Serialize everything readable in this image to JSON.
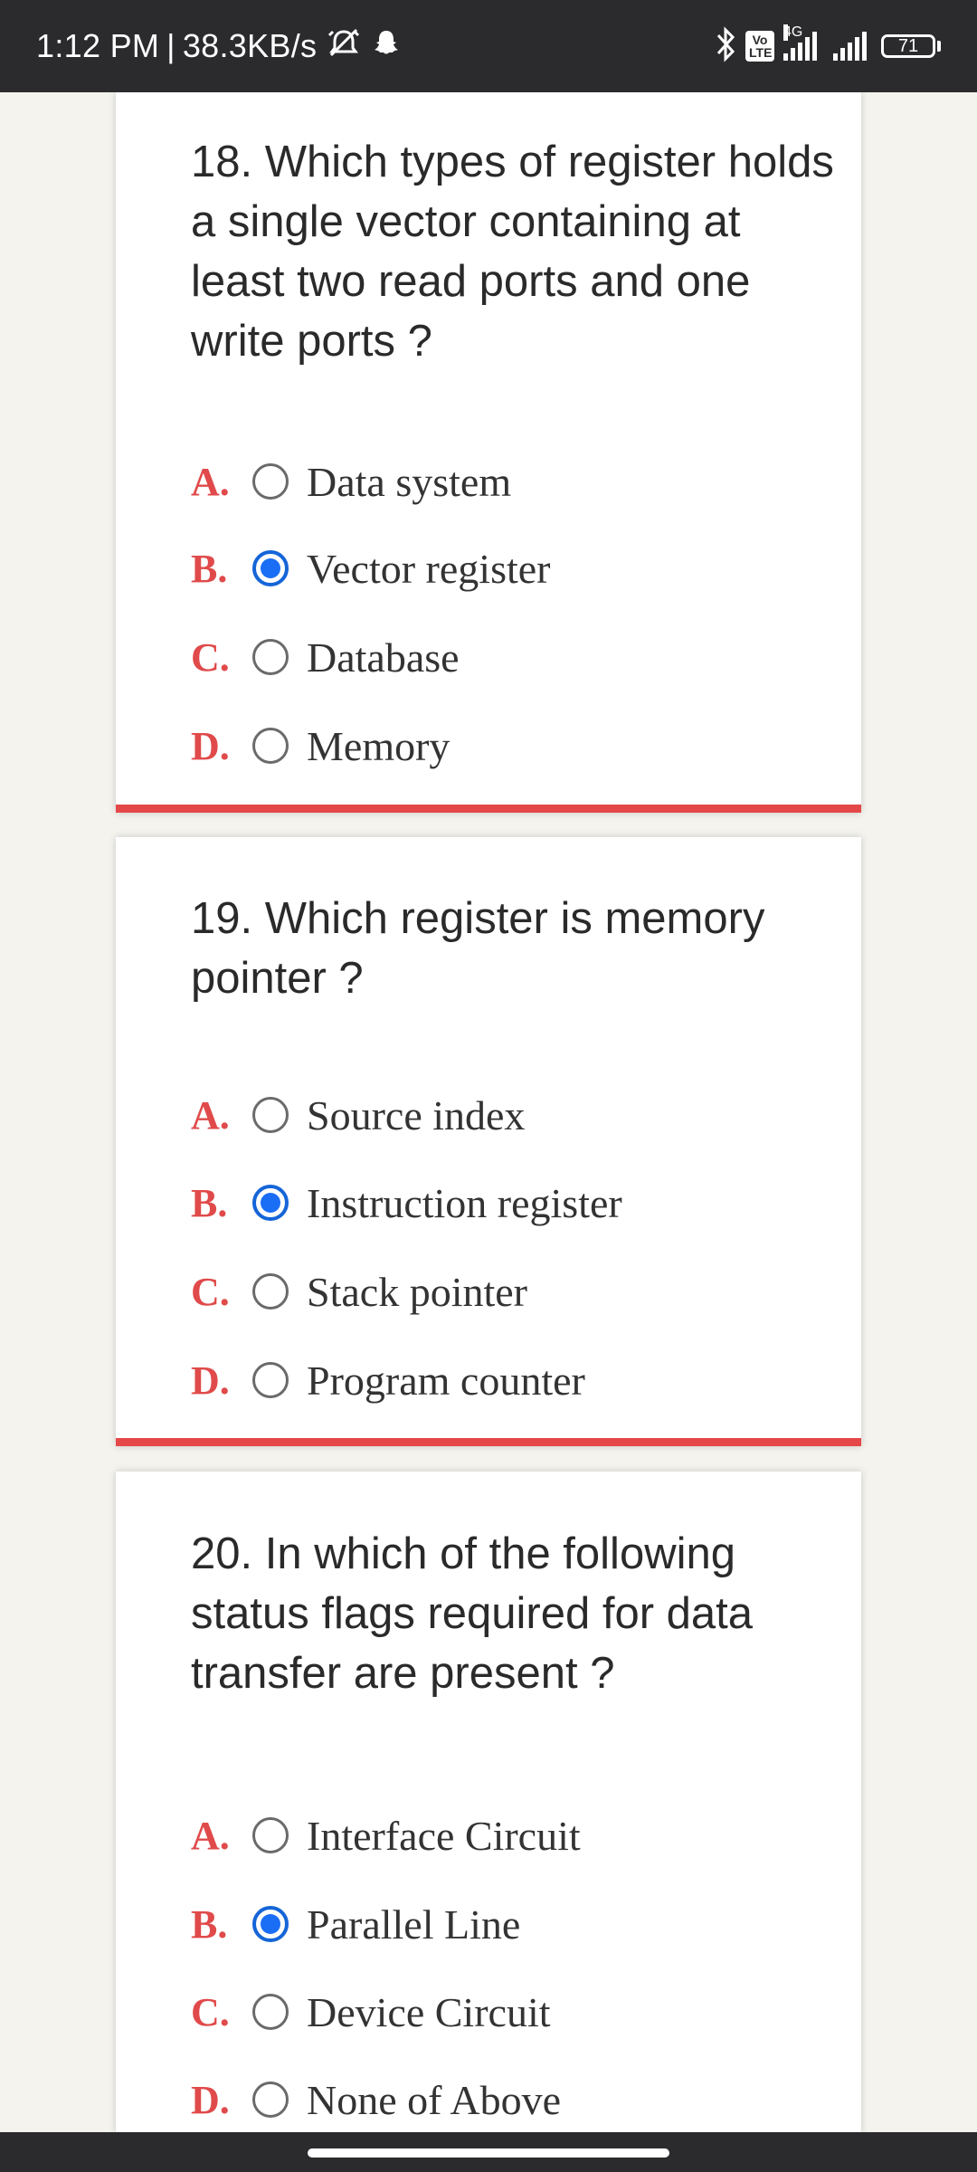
{
  "status_bar": {
    "time": "1:12 PM",
    "separator": "|",
    "speed": "38.3KB/s",
    "icons": [
      "alarm-off-icon",
      "snapchat-icon",
      "bluetooth-icon",
      "volte-icon",
      "signal-4g-icon",
      "signal-icon",
      "battery-icon"
    ],
    "volte_label": "Vo LTE",
    "network_type": "4G",
    "battery_level": "71"
  },
  "questions": [
    {
      "text": "18. Which types of register holds a single vector containing at least two read ports and one write ports ?",
      "selected": 1,
      "options": [
        {
          "letter": "A.",
          "text": "Data system"
        },
        {
          "letter": "B.",
          "text": "Vector register"
        },
        {
          "letter": "C.",
          "text": "Database"
        },
        {
          "letter": "D.",
          "text": "Memory"
        }
      ]
    },
    {
      "text": "19. Which register is memory pointer ?",
      "selected": 1,
      "options": [
        {
          "letter": "A.",
          "text": "Source index"
        },
        {
          "letter": "B.",
          "text": "Instruction register"
        },
        {
          "letter": "C.",
          "text": "Stack pointer"
        },
        {
          "letter": "D.",
          "text": "Program counter"
        }
      ]
    },
    {
      "text": "20. In which of the following status flags required for data transfer are present ?",
      "selected": 1,
      "options": [
        {
          "letter": "A.",
          "text": "Interface Circuit"
        },
        {
          "letter": "B.",
          "text": "Parallel Line"
        },
        {
          "letter": "C.",
          "text": "Device Circuit"
        },
        {
          "letter": "D.",
          "text": "None of Above"
        }
      ]
    }
  ],
  "colors": {
    "accent_red": "#e54848",
    "selected_blue": "#1a6ef5",
    "status_bar_bg": "#2b2b2e",
    "page_bg": "#f4f3ee"
  }
}
